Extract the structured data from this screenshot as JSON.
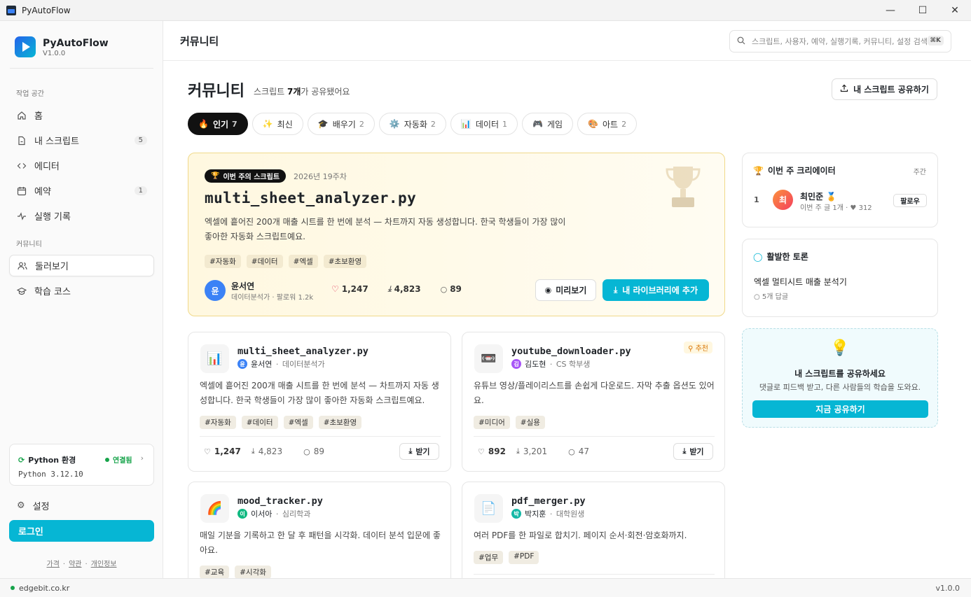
{
  "window": {
    "title": "PyAutoFlow"
  },
  "sidebar": {
    "brand": "PyAutoFlow",
    "version": "V1.0.0",
    "section_workspace": "작업 공간",
    "section_community": "커뮤니티",
    "items": [
      {
        "label": "홈",
        "icon": "home-icon"
      },
      {
        "label": "내 스크립트",
        "count": "5",
        "icon": "file-icon"
      },
      {
        "label": "에디터",
        "icon": "code-icon"
      },
      {
        "label": "예약",
        "count": "1",
        "icon": "calendar-icon"
      },
      {
        "label": "실행 기록",
        "icon": "activity-icon"
      },
      {
        "label": "둘러보기",
        "icon": "users-icon"
      },
      {
        "label": "학습 코스",
        "icon": "graduation-icon"
      }
    ],
    "python_env": {
      "title": "Python 환경",
      "status": "연결됨",
      "version": "Python 3.12.10"
    },
    "settings": "설정",
    "login": "로그인",
    "links": [
      "가격",
      "약관",
      "개인정보"
    ]
  },
  "topbar": {
    "title": "커뮤니티",
    "search_placeholder": "스크립트, 사용자, 예약, 실행기록, 커뮤니티, 설정 검색",
    "shortcut": "⌘K"
  },
  "page": {
    "heading": "커뮤니티",
    "sub_prefix": "스크립트 ",
    "sub_count": "7개",
    "sub_suffix": "가 공유됐어요",
    "share_button": "내 스크립트 공유하기"
  },
  "tabs": [
    {
      "emoji": "🔥",
      "label": "인기",
      "count": "7"
    },
    {
      "emoji": "✨",
      "label": "최신",
      "count": ""
    },
    {
      "emoji": "🎓",
      "label": "배우기",
      "count": "2"
    },
    {
      "emoji": "⚙️",
      "label": "자동화",
      "count": "2"
    },
    {
      "emoji": "📊",
      "label": "데이터",
      "count": "1"
    },
    {
      "emoji": "🎮",
      "label": "게임",
      "count": ""
    },
    {
      "emoji": "🎨",
      "label": "아트",
      "count": "2"
    }
  ],
  "featured": {
    "badge": "이번 주의 스크립트",
    "week": "2026년 19주차",
    "title": "multi_sheet_analyzer.py",
    "desc": "엑셀에 흩어진 200개 매출 시트를 한 번에 분석 — 차트까지 자동 생성합니다. 한국 학생들이 가장 많이 좋아한 자동화 스크립트예요.",
    "tags": [
      "#자동화",
      "#데이터",
      "#엑셀",
      "#초보환영"
    ],
    "author": {
      "initial": "윤",
      "name": "윤서연",
      "meta": "데이터분석가 · 팔로워 1.2k"
    },
    "likes": "1,247",
    "downloads": "4,823",
    "comments": "89",
    "preview_button": "미리보기",
    "add_button": "내 라이브러리에 추가"
  },
  "cards": [
    {
      "emoji": "📊",
      "title": "multi_sheet_analyzer.py",
      "author_initial": "윤",
      "author": "윤서연",
      "role": "데이터분석가",
      "color": "#3b82f6",
      "desc": "엑셀에 흩어진 200개 매출 시트를 한 번에 분석 — 차트까지 자동 생성합니다. 한국 학생들이 가장 많이 좋아한 자동화 스크립트예요.",
      "tags": [
        "#자동화",
        "#데이터",
        "#엑셀",
        "#초보환영"
      ],
      "likes": "1,247",
      "downloads": "4,823",
      "comments": "89",
      "get": "받기",
      "rec": ""
    },
    {
      "emoji": "📼",
      "title": "youtube_downloader.py",
      "author_initial": "김",
      "author": "김도현",
      "role": "CS 학부생",
      "color": "#a855f7",
      "desc": "유튜브 영상/플레이리스트를 손쉽게 다운로드. 자막 추출 옵션도 있어요.",
      "tags": [
        "#미디어",
        "#실용"
      ],
      "likes": "892",
      "downloads": "3,201",
      "comments": "47",
      "get": "받기",
      "rec": "추천"
    },
    {
      "emoji": "🌈",
      "title": "mood_tracker.py",
      "author_initial": "이",
      "author": "이서아",
      "role": "심리학과",
      "color": "#10b981",
      "desc": "매일 기분을 기록하고 한 달 후 패턴을 시각화. 데이터 분석 입문에 좋아요.",
      "tags": [
        "#교육",
        "#시각화"
      ],
      "likes": "",
      "downloads": "",
      "comments": "",
      "get": "",
      "rec": ""
    },
    {
      "emoji": "📄",
      "title": "pdf_merger.py",
      "author_initial": "박",
      "author": "박지훈",
      "role": "대학원생",
      "color": "#14b8a6",
      "desc": "여러 PDF를 한 파일로 합치기. 페이지 순서·회전·암호화까지.",
      "tags": [
        "#업무",
        "#PDF"
      ],
      "likes": "",
      "downloads": "",
      "comments": "",
      "get": "",
      "rec": ""
    }
  ],
  "creators": {
    "title": "이번 주 크리에이터",
    "period": "주간",
    "rank": "1",
    "initial": "최",
    "name": "최민준",
    "meta": "이번 주 글 1개 · ♥ 312",
    "follow": "팔로우"
  },
  "discussion": {
    "title": "활발한 토론",
    "topic": "엑셀 멀티시트 매출 분석기",
    "replies": "5개 답글"
  },
  "cta": {
    "title": "내 스크립트를 공유하세요",
    "desc": "댓글로 피드백 받고, 다른 사람들의 학습을 도와요.",
    "button": "지금 공유하기"
  },
  "footer": {
    "domain": "edgebit.co.kr",
    "version": "v1.0.0"
  },
  "colors": {
    "accent": "#06b6d4",
    "featured_border": "#f0d98a"
  }
}
